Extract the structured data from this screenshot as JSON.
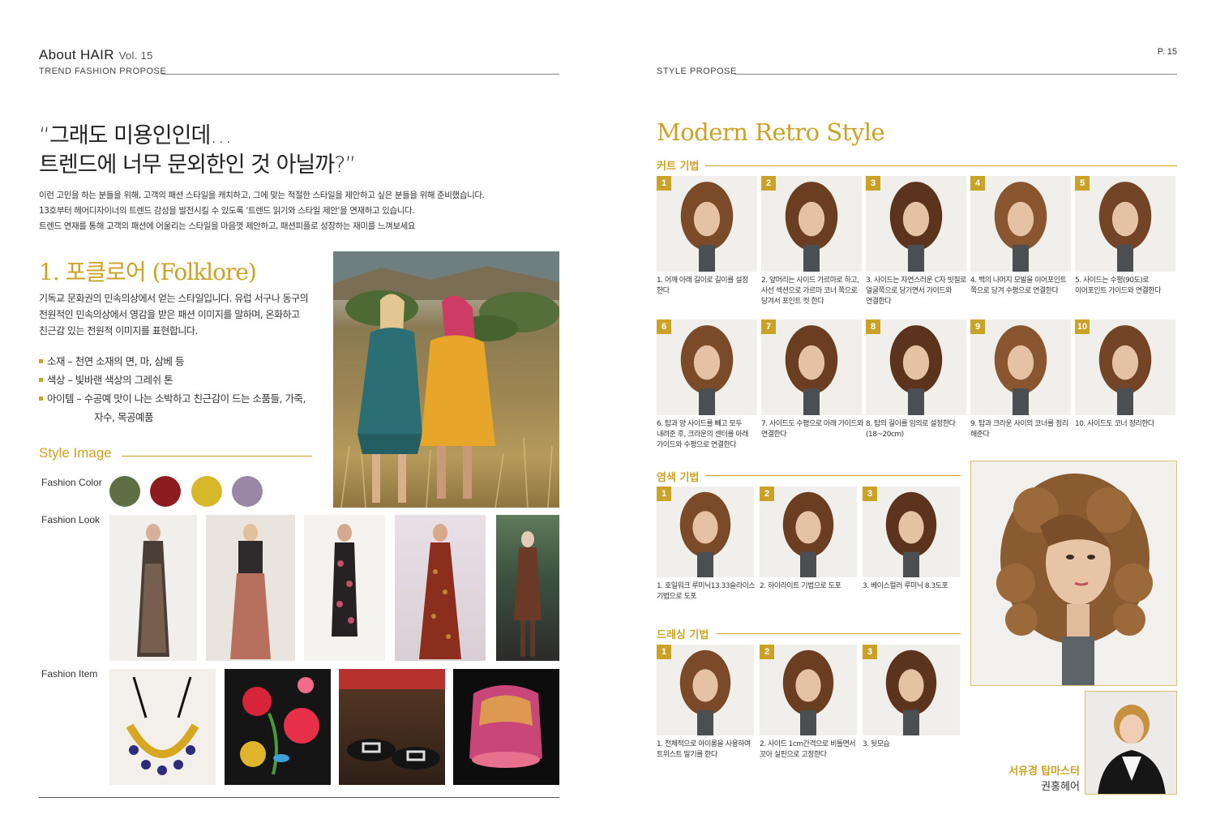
{
  "left_header": {
    "brand": "About HAIR",
    "volume": "Vol. 15",
    "subtitle": "TREND FASHION PROPOSE"
  },
  "right_header": {
    "subtitle": "STYLE PROPOSE",
    "page": "P. 15"
  },
  "headline": {
    "line1": "“그래도 미용인인데…",
    "line2": "트렌드에 너무 문외한인 것 아닐까?”"
  },
  "intro": {
    "line1": "이런 고민을 하는 분들을 위해, 고객의 패션 스타일을 캐치하고, 그에 맞는 적절한 스타일을 제안하고 싶은 분들을 위해 준비했습니다.",
    "line2": "13호부터 헤어디자이너의 트렌드 감성을 발전시킬 수 있도록 '트렌드 읽기와 스타일 제안'을 연재하고 있습니다.",
    "line3": "트렌드 연재를 통해 고객의 패션에 어울리는 스타일을 마음껏 제안하고, 패션피플로 성장하는 재미를 느껴보세요"
  },
  "section": {
    "number": "1.",
    "title": "포클로어 (Folklore)",
    "desc1": "기독교 문화권의 민속의상에서 얻는 스타일입니다. 유럽 서구나 동구의",
    "desc2": "전원적인 민속의상에서 영감을 받은 패션 이미지를 말하며, 온화하고",
    "desc3": "친근감 있는 전원적 이미지를 표현합니다.",
    "bullet1": "소재 – 천연 소재의 면, 마, 삼베 등",
    "bullet2": "색상 – 빛바랜 색상의 그레쉬 톤",
    "bullet3a": "아이템 – 수공예 맛이 나는 소박하고 친근감이 드는 소품들, 가죽,",
    "bullet3b": "자수, 목공예품"
  },
  "style_image": {
    "heading": "Style Image",
    "color_label": "Fashion Color",
    "look_label": "Fashion Look",
    "item_label": "Fashion Item",
    "colors": [
      "#5e6e45",
      "#8c1c1e",
      "#d6b82a",
      "#9a87a6"
    ]
  },
  "modern": {
    "title": "Modern Retro Style",
    "cut_header": "커트 기법",
    "color_header": "염색 기법",
    "dress_header": "드레싱 기법",
    "cut_steps": [
      {
        "num": "1",
        "cap1": "1. 어깨 아래 길이로 길이를 설정",
        "cap2": "한다",
        "cap3": ""
      },
      {
        "num": "2",
        "cap1": "2. 앞머리는 사이드 가르마로 하고,",
        "cap2": "사선 섹션으로 가르마 코너 쪽으로",
        "cap3": "당겨서 포인트 컷 한다"
      },
      {
        "num": "3",
        "cap1": "3. 사이드는 자연스러운 C자 빗질로",
        "cap2": "얼굴쪽으로 당기면서 가이드와",
        "cap3": "연결한다"
      },
      {
        "num": "4",
        "cap1": "4. 백의 나머지 모발을 이어포인트",
        "cap2": "쪽으로 당겨 수평으로 연결한다",
        "cap3": ""
      },
      {
        "num": "5",
        "cap1": "5. 사이드는 수평(90도)로",
        "cap2": "이어포인트 가이드와 연결한다",
        "cap3": ""
      },
      {
        "num": "6",
        "cap1": "6. 탑과 양 사이드를 빼고 모두",
        "cap2": "내려준 후, 크라운의 센터를 아래",
        "cap3": "가이드와 수평으로 연결한다"
      },
      {
        "num": "7",
        "cap1": "7. 사이드도 수평으로 아래 가이드와",
        "cap2": "연결한다",
        "cap3": ""
      },
      {
        "num": "8",
        "cap1": "8. 탑의 길이를 임의로 설정한다",
        "cap2": "(18~20cm)",
        "cap3": ""
      },
      {
        "num": "9",
        "cap1": "9. 탑과 크라운 사이의 코너를 정리",
        "cap2": "해준다",
        "cap3": ""
      },
      {
        "num": "10",
        "cap1": "10. 사이드도 코너 정리한다",
        "cap2": "",
        "cap3": ""
      }
    ],
    "color_steps": [
      {
        "num": "1",
        "cap1": "1. 호일워크 루미닉13.33슬라이스",
        "cap2": "기법으로 도포"
      },
      {
        "num": "2",
        "cap1": "2. 하이라이트 기법으로 도포",
        "cap2": ""
      },
      {
        "num": "3",
        "cap1": "3. 베이스컬러 루미닉 8.3도포",
        "cap2": ""
      }
    ],
    "dress_steps": [
      {
        "num": "1",
        "cap1": "1. 전체적으로 아이롱을 사용하여",
        "cap2": "트위스트 말기를 한다"
      },
      {
        "num": "2",
        "cap1": "2. 사이드 1cm간격으로 비틀면서",
        "cap2": "꼬아 실핀으로 고정한다"
      },
      {
        "num": "3",
        "cap1": "3. 뒷모습",
        "cap2": ""
      }
    ]
  },
  "stylist": {
    "name": "서유경",
    "title": "탑마스터",
    "salon": "권홍헤어"
  }
}
